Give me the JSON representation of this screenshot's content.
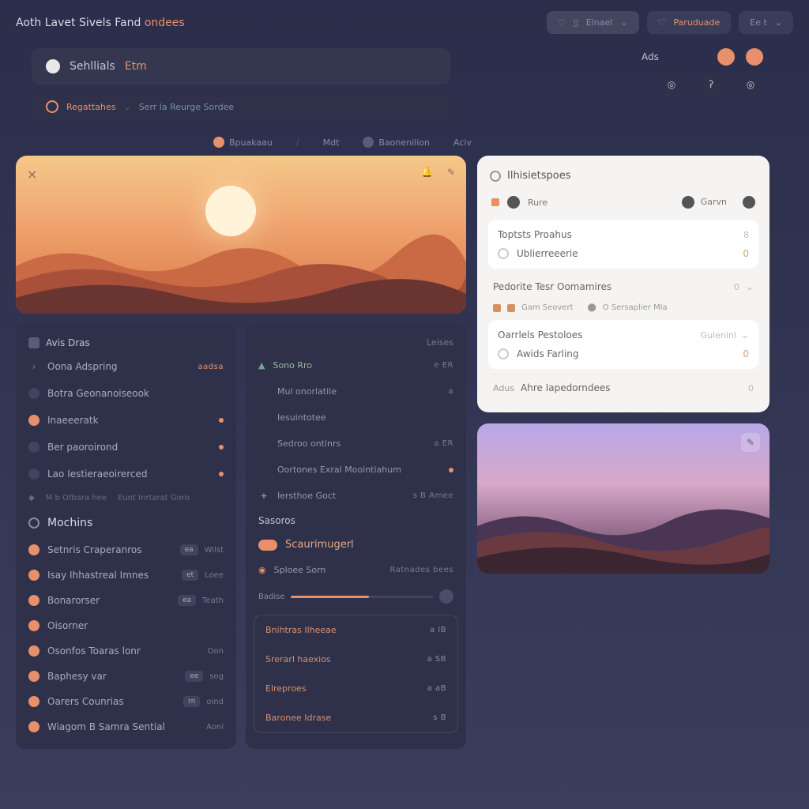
{
  "header": {
    "title_a": "Aoth Lavet",
    "title_b": "Sivels Fand",
    "title_c": "ondees"
  },
  "top_pills": {
    "p1": "Elnael",
    "p2": "Paruduade",
    "p3": "Ee t"
  },
  "search": {
    "a": "Sehllials",
    "b": "Etm"
  },
  "breadcrumb": {
    "a": "Regattahes",
    "b": "Serr la Reurge Sordee"
  },
  "tabs": {
    "t1": "Bpuakaau",
    "t2": "Mdt",
    "t3": "Baonenilion",
    "t4": "Aciv"
  },
  "iconrow": {
    "label": "Ads"
  },
  "cardA": {
    "head": "Avis Dras",
    "right": "",
    "items": [
      {
        "t": "Oona Adspring",
        "m": "aadsa",
        "chev": true
      },
      {
        "t": "Botra Geonanoiseook",
        "m": "",
        "plain": true
      },
      {
        "t": "Inaeeeratk",
        "dot": true,
        "orange": true
      },
      {
        "t": "Ber paoroirond",
        "dot": true
      },
      {
        "t": "Lao Iestieraeoirerced",
        "dot": true
      }
    ],
    "sep": {
      "a": "M b Ofbara hee",
      "b": "Eunt Inrtarat Goro"
    }
  },
  "mochins": {
    "head": "Mochins",
    "items": [
      {
        "t": "Setnris Craperanros",
        "b": "ea",
        "m": "Wilst"
      },
      {
        "t": "Isay Ihhastreal Imnes",
        "b": "et",
        "m": "Loee"
      },
      {
        "t": "Bonarorser",
        "b": "ea",
        "m": "Teath"
      },
      {
        "t": "Oisorner",
        "b": "",
        "m": ""
      },
      {
        "t": "Osonfos Toaras lonr",
        "b": "",
        "m": "Oon"
      },
      {
        "t": "Baphesy var",
        "b": "ee",
        "m": "sog"
      },
      {
        "t": "Oarers Counrias",
        "b": "rn",
        "m": "oind"
      },
      {
        "t": "Wiagom B Samra Sential",
        "b": "",
        "m": "Aoni"
      }
    ]
  },
  "cardB": {
    "right": "Leises",
    "items": [
      {
        "t": "Sono Rro",
        "m": "e ER",
        "flame": true
      },
      {
        "t": "Mul onorlatile",
        "m": "a"
      },
      {
        "t": "Iesuintotee",
        "m": ""
      },
      {
        "t": "Sedroo ontinrs",
        "m": "a ER"
      },
      {
        "t": "Oortones Exral Moointiahum",
        "dot": true
      },
      {
        "t": "Iersthoe Goct",
        "m": "s B  Amee",
        "plus": true
      }
    ],
    "sub": "Sasoros",
    "chip": "Scaurimugerl",
    "slider": {
      "label": "Badise",
      "r": "Ratnades bees"
    },
    "sub_item": {
      "t": "Sploee Sorn",
      "r": "Ratnades bees"
    },
    "boxed": [
      {
        "t": "Bnihtras Ilheeae",
        "m": "a lB"
      },
      {
        "t": "Srerarl haexios",
        "m": "a SB"
      },
      {
        "t": "Elreproes",
        "m": "a aB"
      },
      {
        "t": "Baronee Idrase",
        "m": "s B"
      }
    ]
  },
  "panel": {
    "head": "Ilhisietspoes",
    "row1": {
      "a": "Rure",
      "b": "Garvn"
    },
    "card1": {
      "h": "Toptsts Proahus",
      "r": "8",
      "item": {
        "t": "Ublierreeerie",
        "r": "0"
      }
    },
    "row2": {
      "t": "Pedorite Tesr Oomamires",
      "r": "0"
    },
    "micro": {
      "a": "Gam Seovert",
      "b": "O Sersaplier Mla"
    },
    "card2": {
      "h": "Oarrlels Pestoloes",
      "r": "Guleninl",
      "item": {
        "t": "Awids Farling",
        "r": "0"
      }
    },
    "row3": {
      "a": "Adus",
      "b": "Ahre Iapedorndees",
      "r": "0"
    }
  }
}
